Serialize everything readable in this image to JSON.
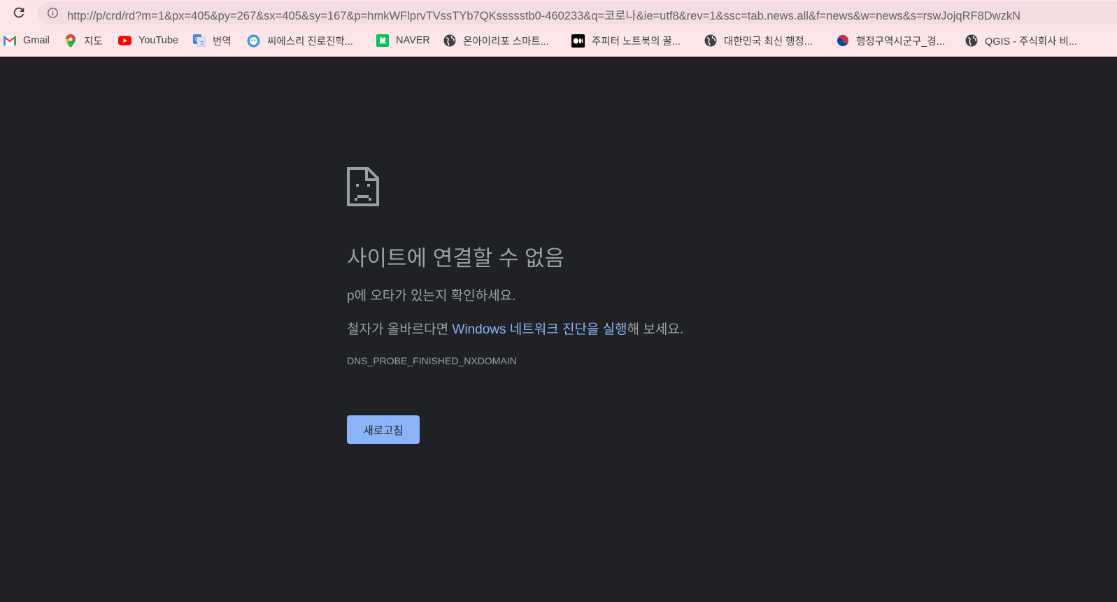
{
  "browser": {
    "url": "http://p/crd/rd?m=1&px=405&py=267&sx=405&sy=167&p=hmkWFlprvTVssTYb7QKssssstb0-460233&q=코로나&ie=utf8&rev=1&ssc=tab.news.all&f=news&w=news&s=rswJojqRF8DwzkN",
    "reload_icon": "reload-icon",
    "info_icon": "info-icon"
  },
  "bookmarks": [
    {
      "label": "Gmail",
      "icon": "gmail-icon"
    },
    {
      "label": "지도",
      "icon": "maps-icon"
    },
    {
      "label": "YouTube",
      "icon": "youtube-icon"
    },
    {
      "label": "번역",
      "icon": "translate-icon"
    },
    {
      "label": "씨에스리 진로진학...",
      "icon": "site-icon"
    },
    {
      "label": "NAVER",
      "icon": "naver-icon"
    },
    {
      "label": "온아이리포 스마트...",
      "icon": "globe-icon"
    },
    {
      "label": "주피터 노트북의 꿀...",
      "icon": "medium-icon"
    },
    {
      "label": "대한민국 최신 행정...",
      "icon": "globe-icon"
    },
    {
      "label": "행정구역시군구_경...",
      "icon": "taegeuk-icon"
    },
    {
      "label": "QGIS - 주식회사 비...",
      "icon": "globe-icon"
    }
  ],
  "error_page": {
    "icon": "sad-page-icon",
    "title": "사이트에 연결할 수 없음",
    "line1": "p에 오타가 있는지 확인하세요.",
    "line2_prefix": "철자가 올바르다면 ",
    "line2_link": "Windows 네트워크 진단을 실행",
    "line2_suffix": "해 보세요.",
    "error_code": "DNS_PROBE_FINISHED_NXDOMAIN",
    "reload_label": "새로고침"
  },
  "colors": {
    "chrome_bg": "#fde6ea",
    "omnibox_bg": "#f4dde2",
    "page_bg": "#202124",
    "text": "#9aa0a6",
    "link": "#8ab4f8",
    "button_bg": "#8ab4f8"
  }
}
